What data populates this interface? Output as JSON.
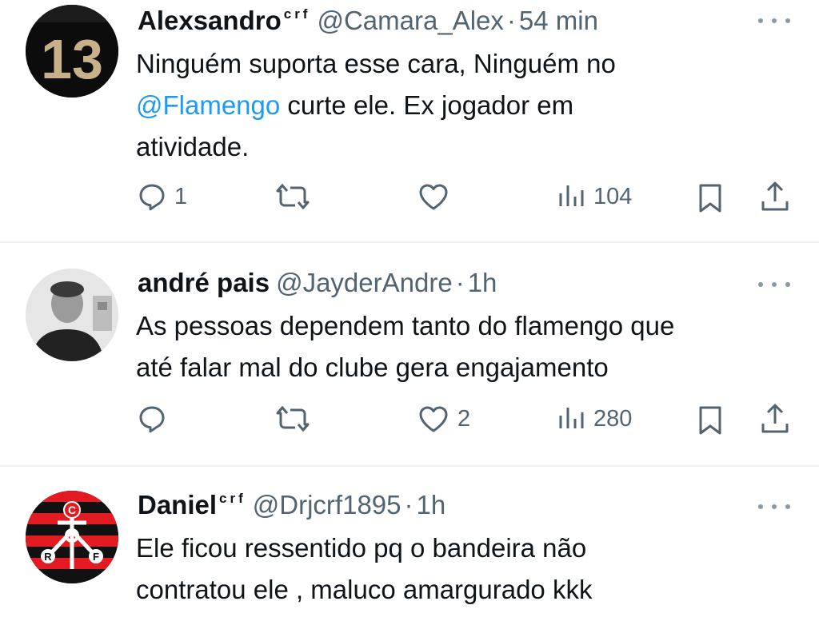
{
  "tweets": [
    {
      "name": "Alexsandro",
      "flair": "crf",
      "handle": "@Camara_Alex",
      "separator": "·",
      "time": "54 min",
      "avatar_number": "13",
      "text_lines": [
        {
          "before": "Ninguém  suporta esse cara, Ninguém no",
          "mention": "",
          "after": ""
        },
        {
          "before": "",
          "mention": "@Flamengo",
          "after": "  curte ele. Ex jogador em"
        },
        {
          "before": "atividade.",
          "mention": "",
          "after": ""
        }
      ],
      "replies": "1",
      "retweets": "",
      "likes": "",
      "views": "104"
    },
    {
      "name": "andré pais",
      "flair": "",
      "handle": "@JayderAndre",
      "separator": "·",
      "time": "1h",
      "text_lines": [
        {
          "before": "As pessoas dependem tanto do flamengo que",
          "mention": "",
          "after": ""
        },
        {
          "before": "até falar mal do clube gera engajamento",
          "mention": "",
          "after": ""
        }
      ],
      "replies": "",
      "retweets": "",
      "likes": "2",
      "views": "280"
    },
    {
      "name": "Daniel",
      "flair": "crf",
      "handle": "@Drjcrf1895",
      "separator": "·",
      "time": "1h",
      "avatar_letters": {
        "top": "C",
        "left": "R",
        "right": "F"
      },
      "text_lines": [
        {
          "before": "Ele ficou ressentido pq o bandeira não",
          "mention": "",
          "after": ""
        },
        {
          "before": "contratou ele   , maluco amargurado kkk",
          "mention": "",
          "after": ""
        }
      ]
    }
  ],
  "colors": {
    "text": "#0f1419",
    "secondary": "#536471",
    "link": "#1d9bf0",
    "divider": "#eff3f4",
    "flamengo_red": "#e21b23"
  },
  "icons": {
    "reply": "speech-bubble-icon",
    "retweet": "retweet-arrows-icon",
    "like": "heart-icon",
    "views": "bar-chart-icon",
    "bookmark": "bookmark-icon",
    "share": "share-upload-icon",
    "more": "more-dots-icon"
  }
}
